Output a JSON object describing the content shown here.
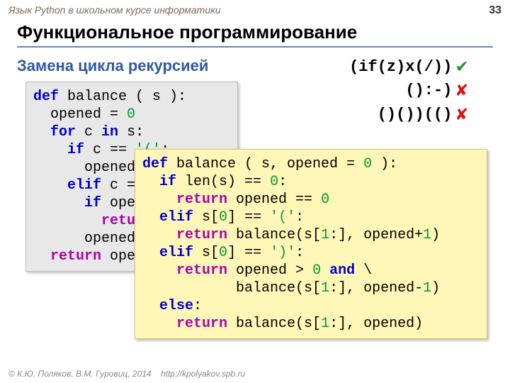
{
  "header": {
    "course": "Язык Python в школьном курсе информатики",
    "page": "33"
  },
  "title": "Функциональное программирование",
  "subtitle": "Замена цикла рекурсией",
  "examples": {
    "e1": "(if(z)x(/))",
    "e2": "():-)",
    "e3": "()())(()"
  },
  "code1": {
    "l1a": "def",
    "l1b": " balance ( s ):",
    "l2a": "  opened = ",
    "l2b": "0",
    "l3a": "  ",
    "l3b": "for",
    "l3c": " c ",
    "l3d": "in",
    "l3e": " s:",
    "l4a": "    ",
    "l4b": "if",
    "l4c": " c == ",
    "l4d": "'('",
    "l4e": ":",
    "l5": "      opened",
    "l6a": "    ",
    "l6b": "elif",
    "l6c": " c =",
    "l7a": "      ",
    "l7b": "if",
    "l7c": " ope",
    "l8a": "        ",
    "l8b": "retu",
    "l9": "      opened",
    "l10a": "  ",
    "l10b": "return",
    "l10c": " ope"
  },
  "code2": {
    "l1a": "def",
    "l1b": " balance ( s, opened = ",
    "l1c": "0",
    "l1d": " ):",
    "l2a": "  ",
    "l2b": "if",
    "l2c": " len(s) == ",
    "l2d": "0",
    "l2e": ":",
    "l3a": "    ",
    "l3b": "return",
    "l3c": " opened == ",
    "l3d": "0",
    "l4a": "  ",
    "l4b": "elif",
    "l4c": " s[",
    "l4d": "0",
    "l4e": "] == ",
    "l4f": "'('",
    "l4g": ":",
    "l5a": "    ",
    "l5b": "return",
    "l5c": " balance(s[",
    "l5d": "1",
    "l5e": ":], opened+",
    "l5f": "1",
    "l5g": ")",
    "l6a": "  ",
    "l6b": "elif",
    "l6c": " s[",
    "l6d": "0",
    "l6e": "] == ",
    "l6f": "')'",
    "l6g": ":",
    "l7a": "    ",
    "l7b": "return",
    "l7c": " opened > ",
    "l7d": "0",
    "l7e": " ",
    "l7f": "and",
    "l7g": " \\",
    "l8a": "           balance(s[",
    "l8b": "1",
    "l8c": ":], opened-",
    "l8d": "1",
    "l8e": ")",
    "l9a": "  ",
    "l9b": "else",
    "l9c": ":",
    "l10a": "    ",
    "l10b": "return",
    "l10c": " balance(s[",
    "l10d": "1",
    "l10e": ":], opened)"
  },
  "footer": {
    "copyright": "© К.Ю. Поляков, В.М. Гуровиц, 2014",
    "url": "http://kpolyakov.spb.ru"
  }
}
